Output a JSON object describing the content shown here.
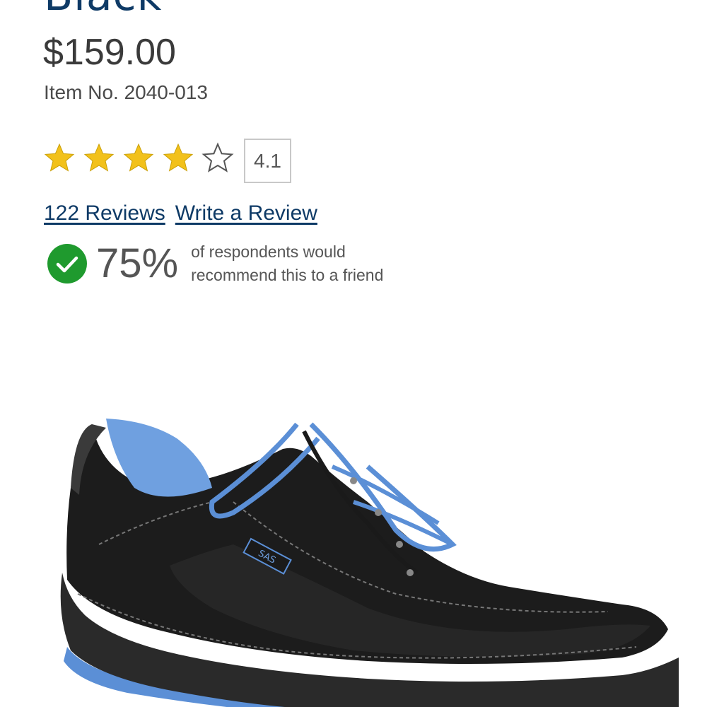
{
  "product": {
    "title": "Black",
    "price": "$159.00",
    "item_number": "Item No. 2040-013"
  },
  "rating": {
    "value": "4.1",
    "stars_filled": 4,
    "stars_total": 5,
    "star_color": "#f2c11b"
  },
  "reviews": {
    "count_link": "122 Reviews",
    "write_link": "Write a Review"
  },
  "recommendation": {
    "percent": "75%",
    "text": "of respondents would recommend this to a friend",
    "icon": "check-circle-icon",
    "icon_color": "#1f9a2e"
  },
  "colors": {
    "title": "#0e3a66",
    "link": "#0e3a66",
    "text": "#3a3a3a"
  },
  "image": {
    "subject": "shoe-image",
    "brand_tag": "SAS"
  }
}
